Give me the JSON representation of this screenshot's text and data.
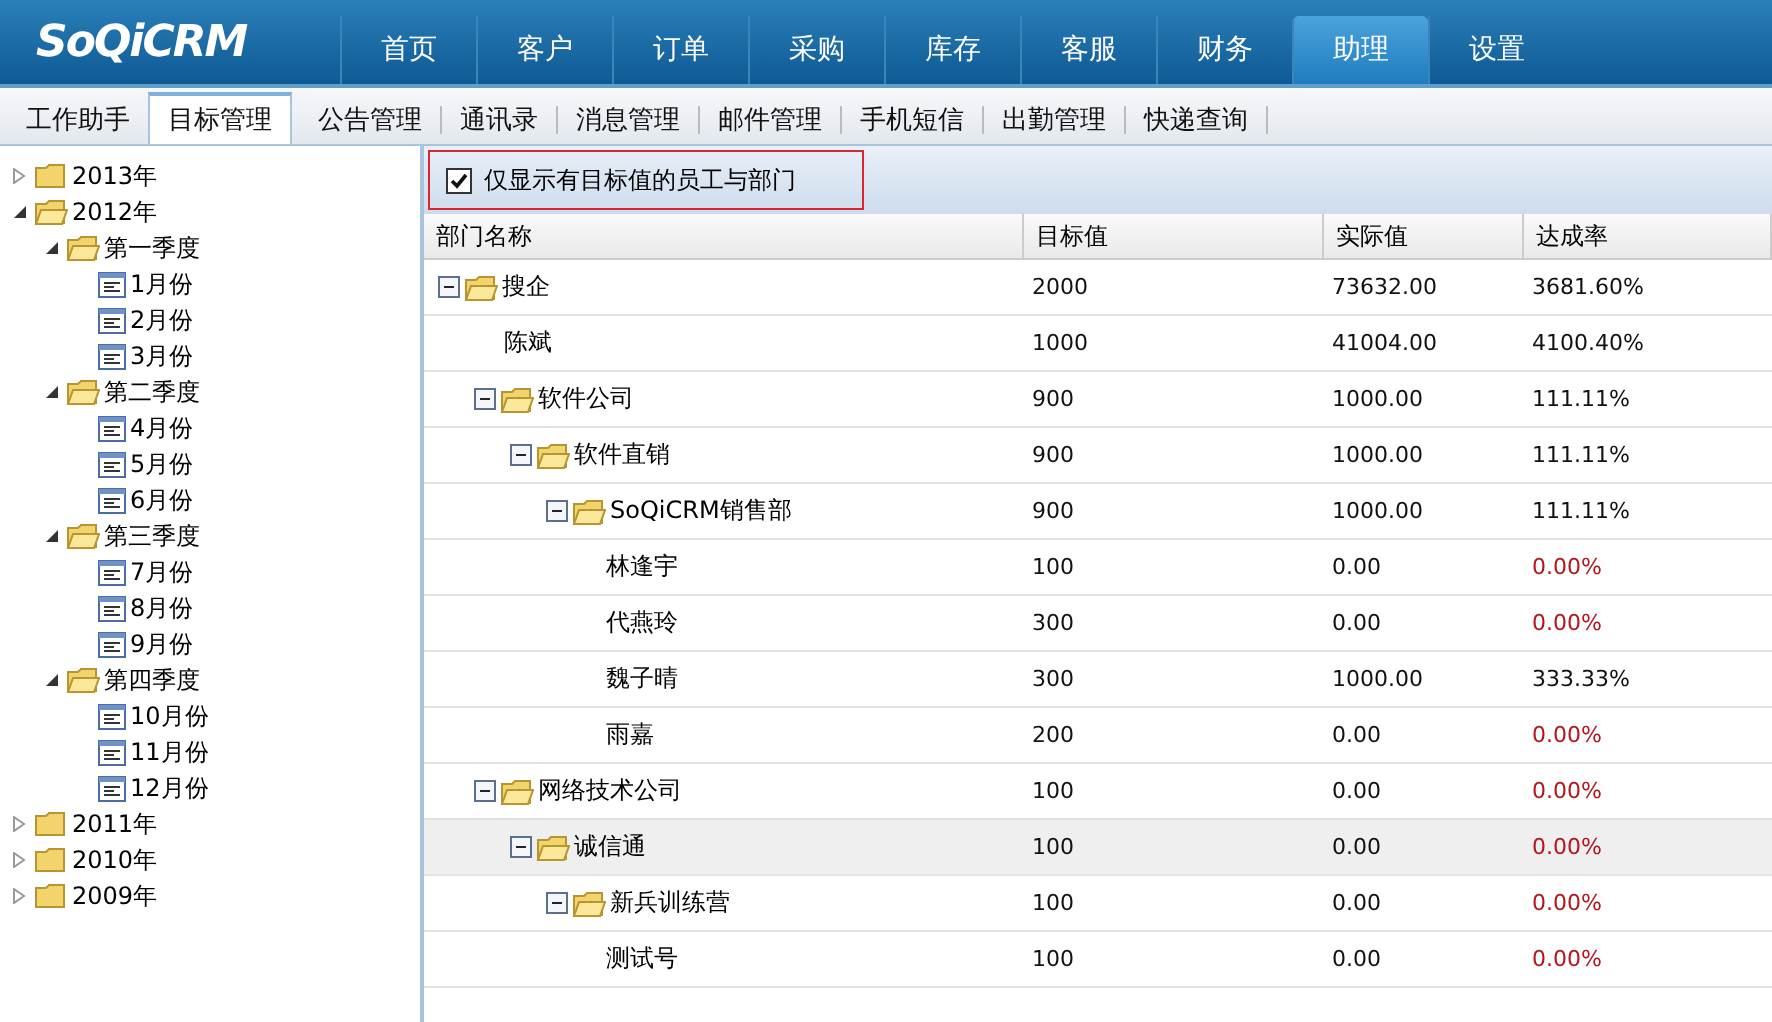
{
  "logo": "SoQiCRM",
  "nav": [
    {
      "label": "首页",
      "selected": false
    },
    {
      "label": "客户",
      "selected": false
    },
    {
      "label": "订单",
      "selected": false
    },
    {
      "label": "采购",
      "selected": false
    },
    {
      "label": "库存",
      "selected": false
    },
    {
      "label": "客服",
      "selected": false
    },
    {
      "label": "财务",
      "selected": false
    },
    {
      "label": "助理",
      "selected": true
    },
    {
      "label": "设置",
      "selected": false
    }
  ],
  "subnav": [
    {
      "label": "工作助手",
      "selected": false
    },
    {
      "label": "目标管理",
      "selected": true
    },
    {
      "label": "公告管理",
      "selected": false
    },
    {
      "label": "通讯录",
      "selected": false
    },
    {
      "label": "消息管理",
      "selected": false
    },
    {
      "label": "邮件管理",
      "selected": false
    },
    {
      "label": "手机短信",
      "selected": false
    },
    {
      "label": "出勤管理",
      "selected": false
    },
    {
      "label": "快递查询",
      "selected": false
    }
  ],
  "tree": [
    {
      "label": "2013年",
      "kind": "folder",
      "expanded": false
    },
    {
      "label": "2012年",
      "kind": "folder",
      "expanded": true,
      "children": [
        {
          "label": "第一季度",
          "kind": "folder",
          "expanded": true,
          "children": [
            {
              "label": "1月份",
              "kind": "leaf"
            },
            {
              "label": "2月份",
              "kind": "leaf"
            },
            {
              "label": "3月份",
              "kind": "leaf"
            }
          ]
        },
        {
          "label": "第二季度",
          "kind": "folder",
          "expanded": true,
          "children": [
            {
              "label": "4月份",
              "kind": "leaf"
            },
            {
              "label": "5月份",
              "kind": "leaf"
            },
            {
              "label": "6月份",
              "kind": "leaf"
            }
          ]
        },
        {
          "label": "第三季度",
          "kind": "folder",
          "expanded": true,
          "children": [
            {
              "label": "7月份",
              "kind": "leaf"
            },
            {
              "label": "8月份",
              "kind": "leaf"
            },
            {
              "label": "9月份",
              "kind": "leaf"
            }
          ]
        },
        {
          "label": "第四季度",
          "kind": "folder",
          "expanded": true,
          "children": [
            {
              "label": "10月份",
              "kind": "leaf"
            },
            {
              "label": "11月份",
              "kind": "leaf"
            },
            {
              "label": "12月份",
              "kind": "leaf"
            }
          ]
        }
      ]
    },
    {
      "label": "2011年",
      "kind": "folder",
      "expanded": false
    },
    {
      "label": "2010年",
      "kind": "folder",
      "expanded": false
    },
    {
      "label": "2009年",
      "kind": "folder",
      "expanded": false
    }
  ],
  "filter": {
    "label": "仅显示有目标值的员工与部门",
    "checked": true
  },
  "table": {
    "columns": [
      "部门名称",
      "目标值",
      "实际值",
      "达成率"
    ],
    "rows": [
      {
        "kind": "folder",
        "expanded": true,
        "selected": false,
        "name": "搜企",
        "target": "2000",
        "actual": "73632.00",
        "rate": "3681.60%",
        "low": false,
        "children": [
          {
            "kind": "person",
            "selected": false,
            "name": "陈斌",
            "target": "1000",
            "actual": "41004.00",
            "rate": "4100.40%",
            "low": false
          },
          {
            "kind": "folder",
            "expanded": true,
            "selected": false,
            "name": "软件公司",
            "target": "900",
            "actual": "1000.00",
            "rate": "111.11%",
            "low": false,
            "children": [
              {
                "kind": "folder",
                "expanded": true,
                "selected": false,
                "name": "软件直销",
                "target": "900",
                "actual": "1000.00",
                "rate": "111.11%",
                "low": false,
                "children": [
                  {
                    "kind": "folder",
                    "expanded": true,
                    "selected": false,
                    "name": "SoQiCRM销售部",
                    "target": "900",
                    "actual": "1000.00",
                    "rate": "111.11%",
                    "low": false,
                    "children": [
                      {
                        "kind": "person",
                        "selected": false,
                        "name": "林逢宇",
                        "target": "100",
                        "actual": "0.00",
                        "rate": "0.00%",
                        "low": true
                      },
                      {
                        "kind": "person",
                        "selected": false,
                        "name": "代燕玲",
                        "target": "300",
                        "actual": "0.00",
                        "rate": "0.00%",
                        "low": true
                      },
                      {
                        "kind": "person",
                        "selected": false,
                        "name": "魏子晴",
                        "target": "300",
                        "actual": "1000.00",
                        "rate": "333.33%",
                        "low": false
                      },
                      {
                        "kind": "person",
                        "selected": false,
                        "name": "雨嘉",
                        "target": "200",
                        "actual": "0.00",
                        "rate": "0.00%",
                        "low": true
                      }
                    ]
                  }
                ]
              }
            ]
          },
          {
            "kind": "folder",
            "expanded": true,
            "selected": false,
            "name": "网络技术公司",
            "target": "100",
            "actual": "0.00",
            "rate": "0.00%",
            "low": true,
            "children": [
              {
                "kind": "folder",
                "expanded": true,
                "selected": true,
                "name": "诚信通",
                "target": "100",
                "actual": "0.00",
                "rate": "0.00%",
                "low": true,
                "children": [
                  {
                    "kind": "folder",
                    "expanded": true,
                    "selected": false,
                    "name": "新兵训练营",
                    "target": "100",
                    "actual": "0.00",
                    "rate": "0.00%",
                    "low": true,
                    "children": [
                      {
                        "kind": "person",
                        "selected": false,
                        "name": "测试号",
                        "target": "100",
                        "actual": "0.00",
                        "rate": "0.00%",
                        "low": true
                      }
                    ]
                  }
                ]
              }
            ]
          }
        ]
      }
    ]
  }
}
